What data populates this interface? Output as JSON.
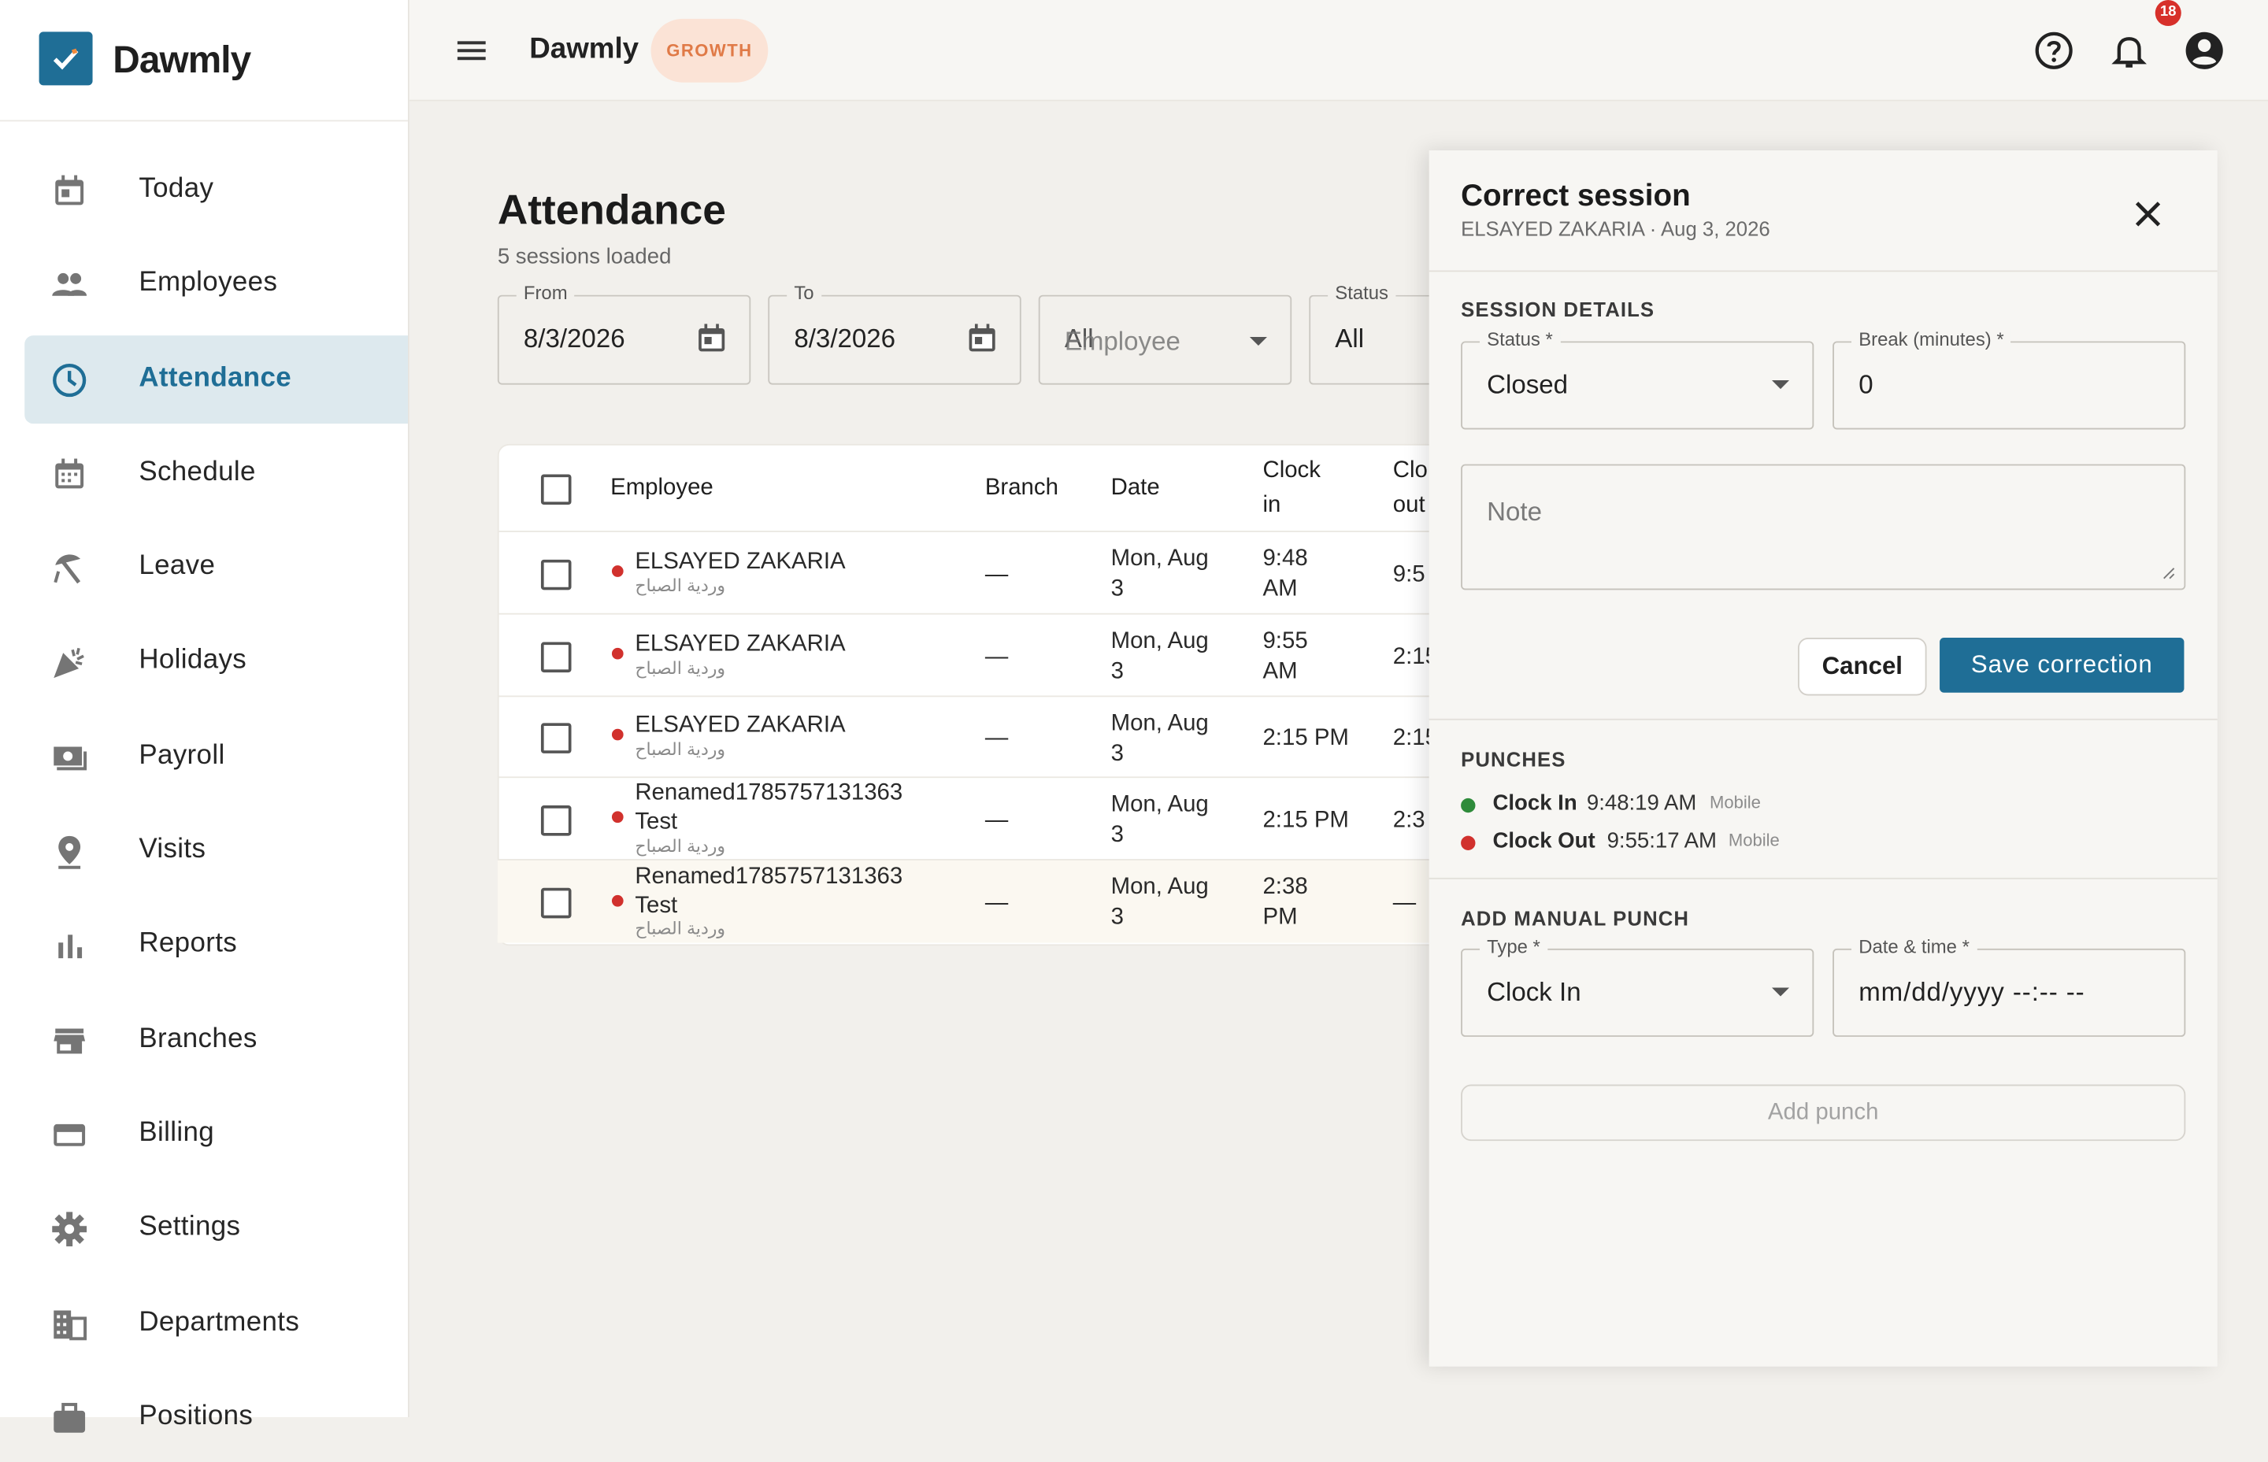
{
  "brand": {
    "name": "Dawmly"
  },
  "sidebar": {
    "items": [
      {
        "label": "Today",
        "icon": "calendar-today-icon"
      },
      {
        "label": "Employees",
        "icon": "people-icon"
      },
      {
        "label": "Attendance",
        "icon": "clock-icon",
        "active": true
      },
      {
        "label": "Schedule",
        "icon": "calendar-grid-icon"
      },
      {
        "label": "Leave",
        "icon": "beach-umbrella-icon"
      },
      {
        "label": "Holidays",
        "icon": "celebration-icon"
      },
      {
        "label": "Payroll",
        "icon": "money-icon"
      },
      {
        "label": "Visits",
        "icon": "location-pin-icon"
      },
      {
        "label": "Reports",
        "icon": "bar-chart-icon"
      },
      {
        "label": "Branches",
        "icon": "store-icon"
      },
      {
        "label": "Billing",
        "icon": "credit-card-icon"
      },
      {
        "label": "Settings",
        "icon": "gear-icon"
      },
      {
        "label": "Departments",
        "icon": "building-icon"
      },
      {
        "label": "Positions",
        "icon": "briefcase-icon"
      }
    ]
  },
  "topbar": {
    "title": "Dawmly",
    "plan": "GROWTH",
    "notification_count": "18"
  },
  "page": {
    "title": "Attendance",
    "subtitle": "5 sessions loaded"
  },
  "filters": {
    "from": {
      "label": "From",
      "value": "8/3/2026"
    },
    "to": {
      "label": "To",
      "value": "8/3/2026"
    },
    "employee": {
      "overlap_text": "All",
      "placeholder": "Employee"
    },
    "status": {
      "label": "Status",
      "value": "All"
    }
  },
  "table": {
    "headers": {
      "employee": "Employee",
      "branch": "Branch",
      "date": "Date",
      "clock_in_1": "Clock",
      "clock_in_2": "in",
      "clock_out_1": "Clo",
      "clock_out_2": "out"
    },
    "rows": [
      {
        "name1": "ELSAYED ZAKARIA",
        "name2": "",
        "shift": "وردية الصباح",
        "branch": "—",
        "date1": "Mon, Aug",
        "date2": "3",
        "in1": "9:48",
        "in2": "AM",
        "out": "9:5"
      },
      {
        "name1": "ELSAYED ZAKARIA",
        "name2": "",
        "shift": "وردية الصباح",
        "branch": "—",
        "date1": "Mon, Aug",
        "date2": "3",
        "in1": "9:55",
        "in2": "AM",
        "out": "2:15"
      },
      {
        "name1": "ELSAYED ZAKARIA",
        "name2": "",
        "shift": "وردية الصباح",
        "branch": "—",
        "date1": "Mon, Aug",
        "date2": "3",
        "in1": "2:15 PM",
        "in2": "",
        "out": "2:15"
      },
      {
        "name1": "Renamed1785757131363",
        "name2": "Test",
        "shift": "وردية الصباح",
        "branch": "—",
        "date1": "Mon, Aug",
        "date2": "3",
        "in1": "2:15 PM",
        "in2": "",
        "out": "2:3"
      },
      {
        "name1": "Renamed1785757131363",
        "name2": "Test",
        "shift": "وردية الصباح",
        "branch": "—",
        "date1": "Mon, Aug",
        "date2": "3",
        "in1": "2:38",
        "in2": "PM",
        "out": "—"
      }
    ]
  },
  "drawer": {
    "title": "Correct session",
    "subtitle": "ELSAYED ZAKARIA · Aug 3, 2026",
    "session_details_title": "SESSION DETAILS",
    "status": {
      "label": "Status *",
      "value": "Closed"
    },
    "break": {
      "label": "Break (minutes) *",
      "value": "0"
    },
    "note": {
      "placeholder": "Note"
    },
    "cancel": "Cancel",
    "save": "Save correction",
    "punches_title": "PUNCHES",
    "punches": [
      {
        "type": "Clock In",
        "time": "9:48:19 AM",
        "source": "Mobile",
        "color": "#2e8b3a"
      },
      {
        "type": "Clock Out",
        "time": "9:55:17 AM",
        "source": "Mobile",
        "color": "#d1312d"
      }
    ],
    "manual_title": "ADD MANUAL PUNCH",
    "manual_type": {
      "label": "Type *",
      "value": "Clock In"
    },
    "manual_datetime": {
      "label": "Date & time *",
      "placeholder": "mm/dd/yyyy --:-- --"
    },
    "add_punch": "Add punch"
  },
  "colors": {
    "accent": "#1f6e96",
    "plan_badge_bg": "#fbe3d6",
    "plan_badge_text": "#e07a47",
    "status_red": "#d1312d",
    "status_green": "#2e8b3a"
  }
}
